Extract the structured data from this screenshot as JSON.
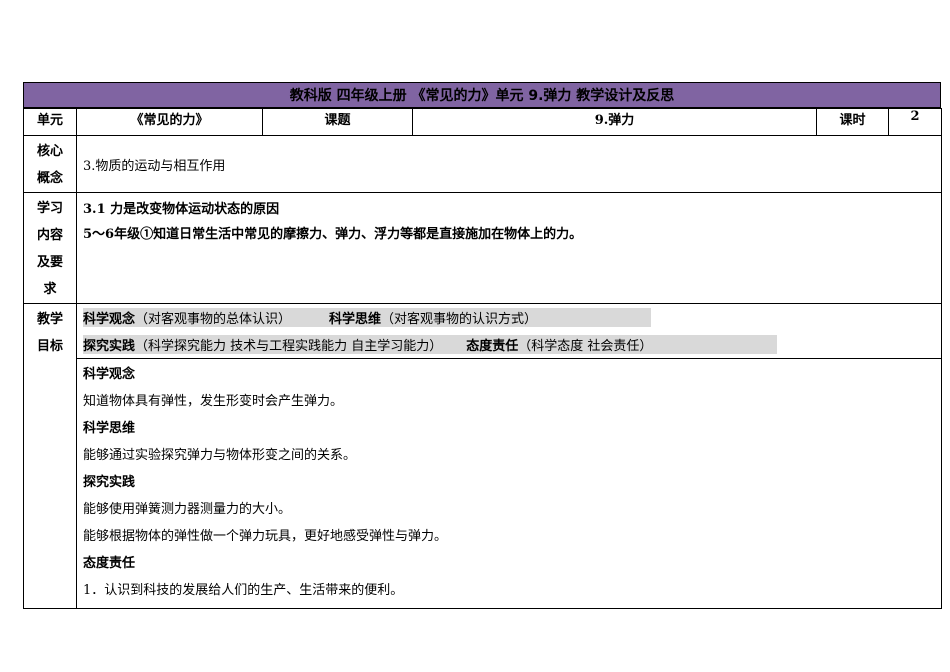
{
  "header": {
    "title": "教科版  四年级上册 《常见的力》单元   9.弹力     教学设计及反思"
  },
  "info_row": {
    "unit_label": "单元",
    "unit_value": "《常见的力》",
    "topic_label": "课题",
    "topic_value": "9.弹力",
    "period_label": "课时",
    "period_value": "2"
  },
  "core_concept": {
    "label_line1": "核心",
    "label_line2": "概念",
    "text": "3.物质的运动与相互作用"
  },
  "learning": {
    "label_lines": [
      "学习",
      "内容",
      "及要",
      "求"
    ],
    "line1": "3.1 力是改变物体运动状态的原因",
    "line2": "5～6年级①知道日常生活中常见的摩擦力、弹力、浮力等都是直接施加在物体上的力。"
  },
  "objectives": {
    "label_line1": "教学",
    "label_line2": "目标",
    "row1_a_bold": "科学观念",
    "row1_a_note": "（对客观事物的总体认识）",
    "row1_b_bold": "科学思维",
    "row1_b_note": "（对客观事物的认识方式）",
    "row2_a_bold": "探究实践",
    "row2_a_note": "（科学探究能力 技术与工程实践能力 自主学习能力）",
    "row2_b_bold": "态度责任",
    "row2_b_note": "（科学态度 社会责任）",
    "sections": [
      {
        "heading": "科学观念",
        "items": [
          "知道物体具有弹性，发生形变时会产生弹力。"
        ]
      },
      {
        "heading": "科学思维",
        "items": [
          "能够通过实验探究弹力与物体形变之间的关系。"
        ]
      },
      {
        "heading": "探究实践",
        "items": [
          "能够使用弹簧测力器测量力的大小。",
          "能够根据物体的弹性做一个弹力玩具，更好地感受弹性与弹力。"
        ]
      },
      {
        "heading": "态度责任",
        "items": [
          "1．认识到科技的发展给人们的生产、生活带来的便利。"
        ]
      }
    ]
  }
}
